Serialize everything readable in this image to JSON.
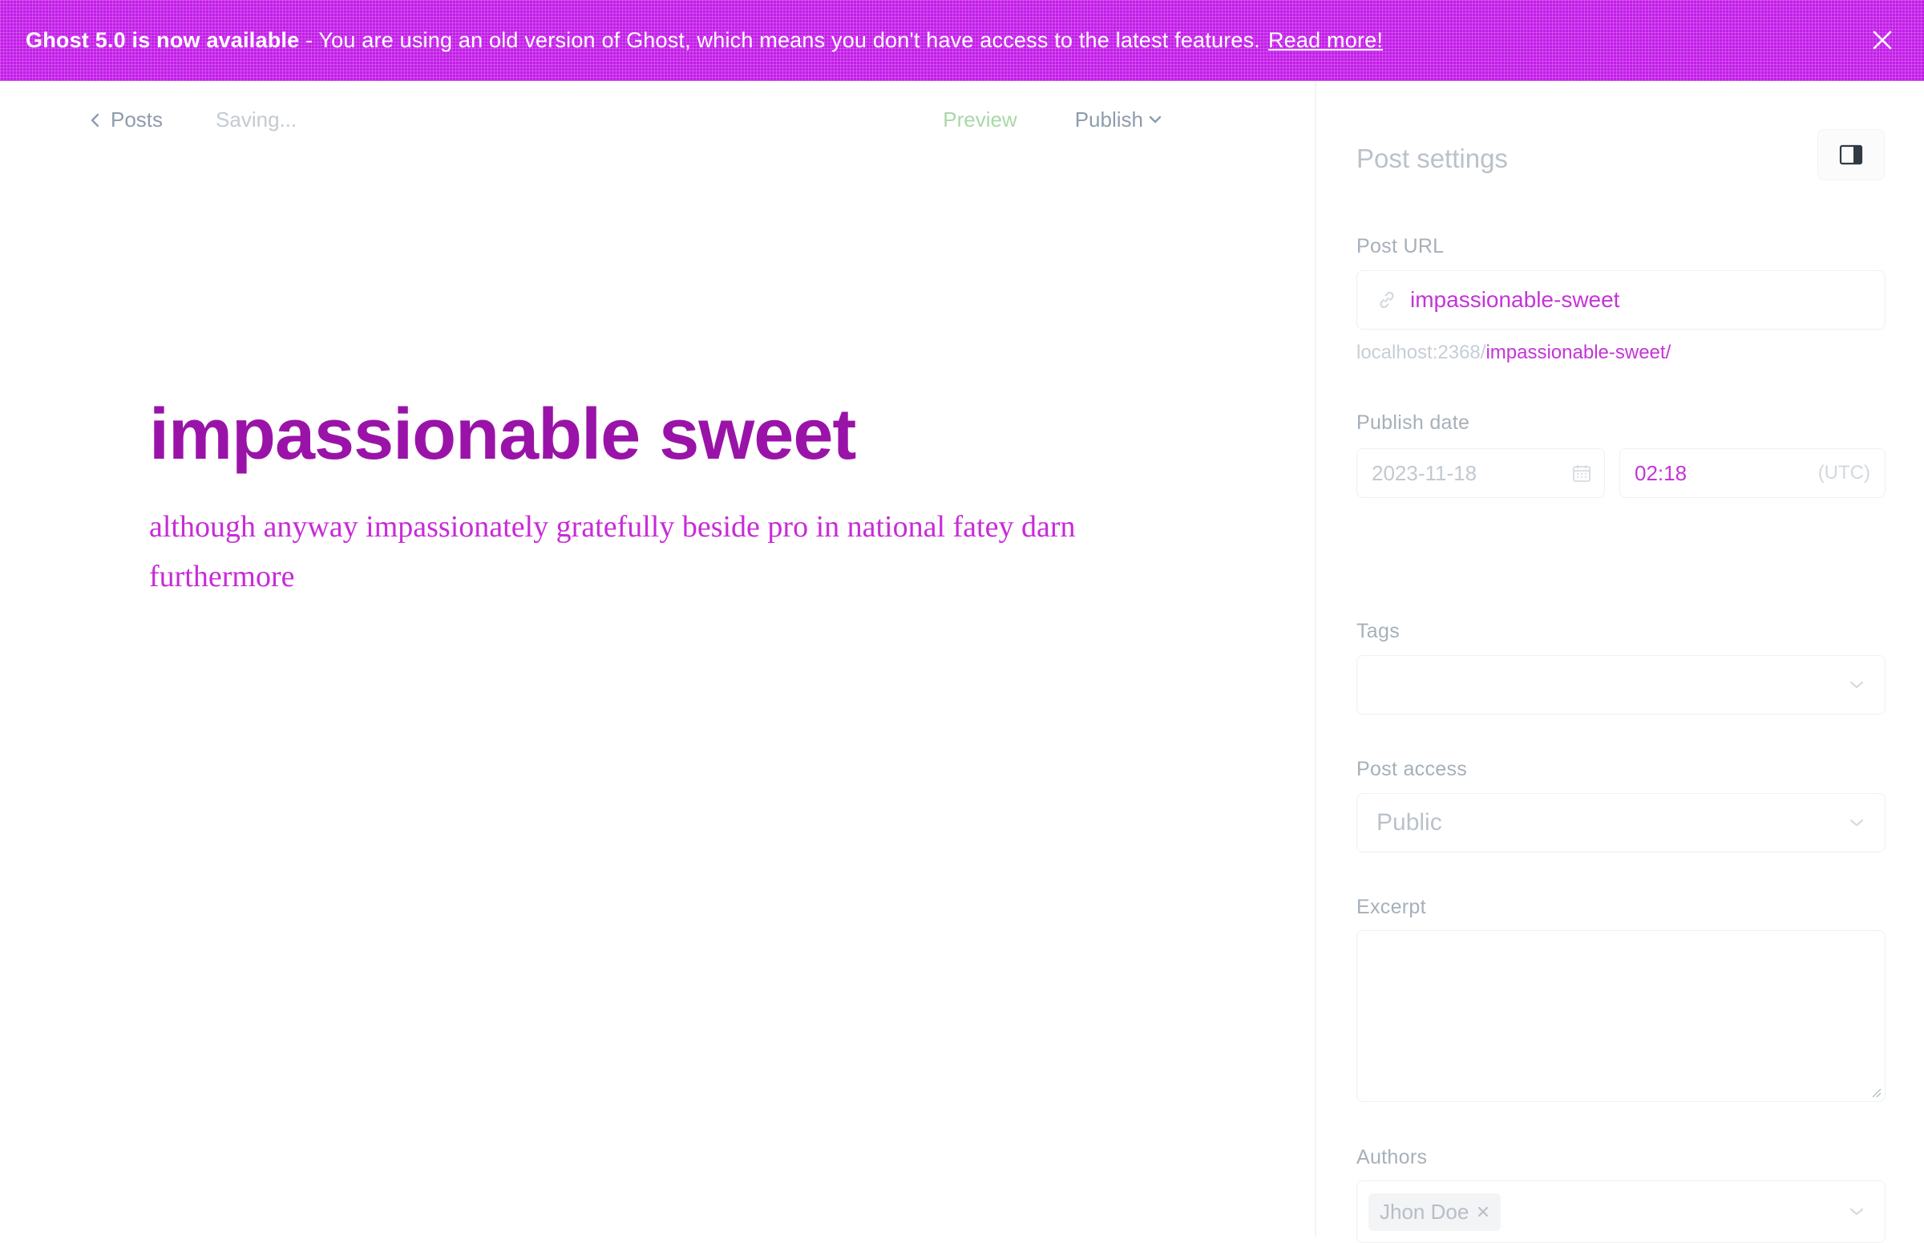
{
  "banner": {
    "version_text": "Ghost 5.0 is now available",
    "message": " - You are using an old version of Ghost, which means you don't have access to the latest features.",
    "link_label": "Read more!"
  },
  "editor": {
    "back_label": "Posts",
    "status": "Saving...",
    "preview_label": "Preview",
    "publish_label": "Publish",
    "title": "impassionable sweet",
    "body": "although anyway impassionately gratefully beside pro in national fatey darn furthermore"
  },
  "settings": {
    "title": "Post settings",
    "post_url_label": "Post URL",
    "slug": "impassionable-sweet",
    "url_prefix": "localhost:2368/",
    "url_slug": "impassionable-sweet/",
    "publish_date_label": "Publish date",
    "date": "2023-11-18",
    "time": "02:18",
    "timezone": "(UTC)",
    "tags_label": "Tags",
    "access_label": "Post access",
    "access_value": "Public",
    "excerpt_label": "Excerpt",
    "authors_label": "Authors",
    "author_name": "Jhon Doe"
  }
}
